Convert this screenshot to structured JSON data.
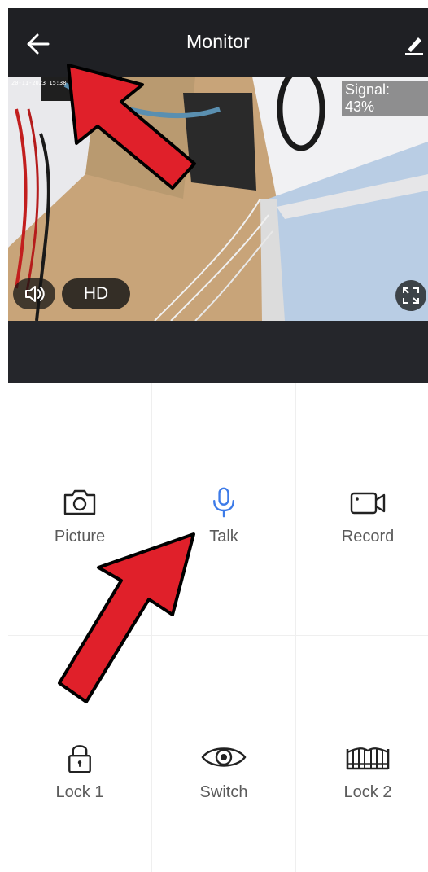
{
  "header": {
    "title": "Monitor",
    "back_icon": "arrow-left-icon",
    "edit_icon": "pencil-icon"
  },
  "video": {
    "timestamp": "20-11-2023 15:38:",
    "signal_label": "Signal:",
    "signal_value": "43%",
    "quality_label": "HD",
    "volume_icon": "speaker-icon",
    "fullscreen_icon": "expand-icon"
  },
  "controls": {
    "picture_label": "Picture",
    "talk_label": "Talk",
    "record_label": "Record",
    "lock1_label": "Lock 1",
    "switch_label": "Switch",
    "lock2_label": "Lock 2"
  },
  "colors": {
    "header_bg": "#1f2024",
    "accent_blue": "#3d7be8",
    "icon_dark": "#222222",
    "label_gray": "#5b5b5b",
    "arrow_red": "#e0202a"
  }
}
